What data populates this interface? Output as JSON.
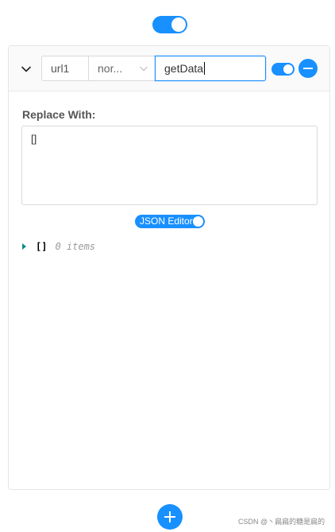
{
  "top_toggle": {
    "on": true
  },
  "rule": {
    "url_field": {
      "value": "url1"
    },
    "method_select": {
      "selected": "nor..."
    },
    "name_field": {
      "value": "getData"
    },
    "enabled": true,
    "replace_label": "Replace With:",
    "replace_value": "[]",
    "json_editor_label": "JSON Editor",
    "json_editor_on": true,
    "json_view": {
      "brackets": "[]",
      "count": "0 items"
    }
  },
  "watermark": "CSDN @丶扁扁的糖是扁的",
  "colors": {
    "accent": "#1890ff",
    "tree_arrow": "#0b8a8a"
  },
  "icons": {
    "collapse": "chevron-down-icon",
    "select": "chevron-down-icon",
    "remove": "minus-icon",
    "add": "plus-icon",
    "tree": "triangle-right-icon"
  }
}
